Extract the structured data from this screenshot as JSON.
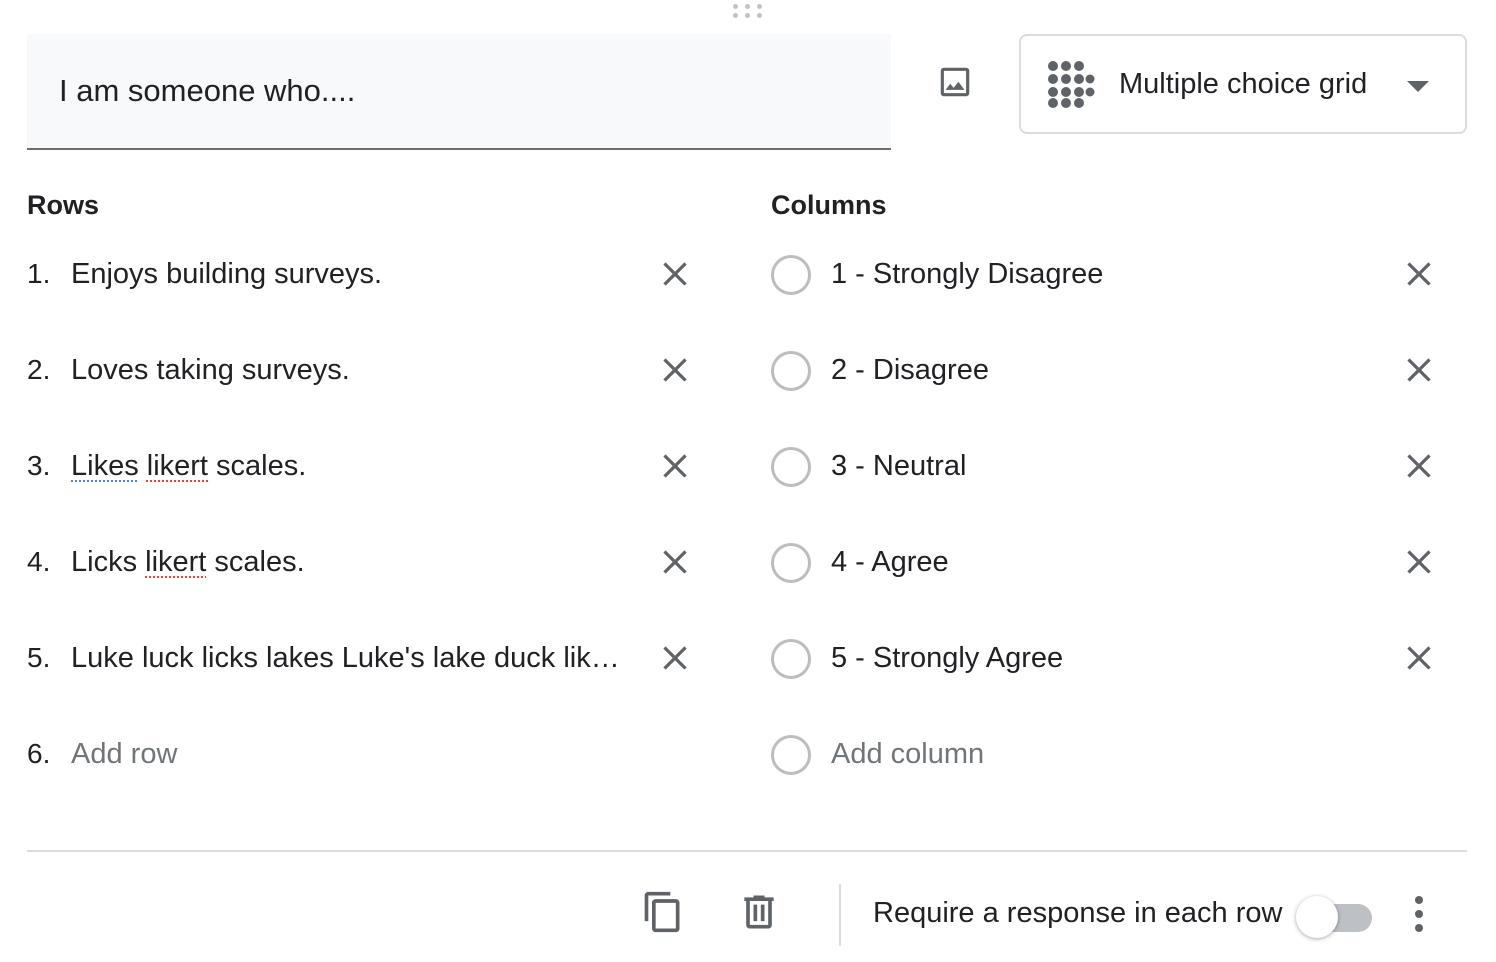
{
  "question": {
    "title": "I am someone who...."
  },
  "question_type": {
    "label": "Multiple choice grid",
    "icon": "grid-icon"
  },
  "rows": {
    "heading": "Rows",
    "items": [
      {
        "number": "1.",
        "text": "Enjoys building surveys."
      },
      {
        "number": "2.",
        "text": "Loves taking surveys."
      },
      {
        "number": "3.",
        "text": "Likes likert scales."
      },
      {
        "number": "4.",
        "text": "Licks likert scales."
      },
      {
        "number": "5.",
        "text": "Luke luck licks lakes Luke's lake duck likes lakes."
      }
    ],
    "add": {
      "number": "6.",
      "text": "Add row"
    }
  },
  "columns": {
    "heading": "Columns",
    "items": [
      {
        "text": "1 - Strongly Disagree"
      },
      {
        "text": "2 - Disagree"
      },
      {
        "text": "3 - Neutral"
      },
      {
        "text": "4 - Agree"
      },
      {
        "text": "5 - Strongly Agree"
      }
    ],
    "add": {
      "text": "Add column"
    }
  },
  "footer": {
    "require_label": "Require a response in each row",
    "require_enabled": false
  },
  "colors": {
    "text": "#202124",
    "icon": "#5f6368",
    "placeholder": "#70757a",
    "border": "#dadce0",
    "field_bg": "#f8f9fa"
  }
}
